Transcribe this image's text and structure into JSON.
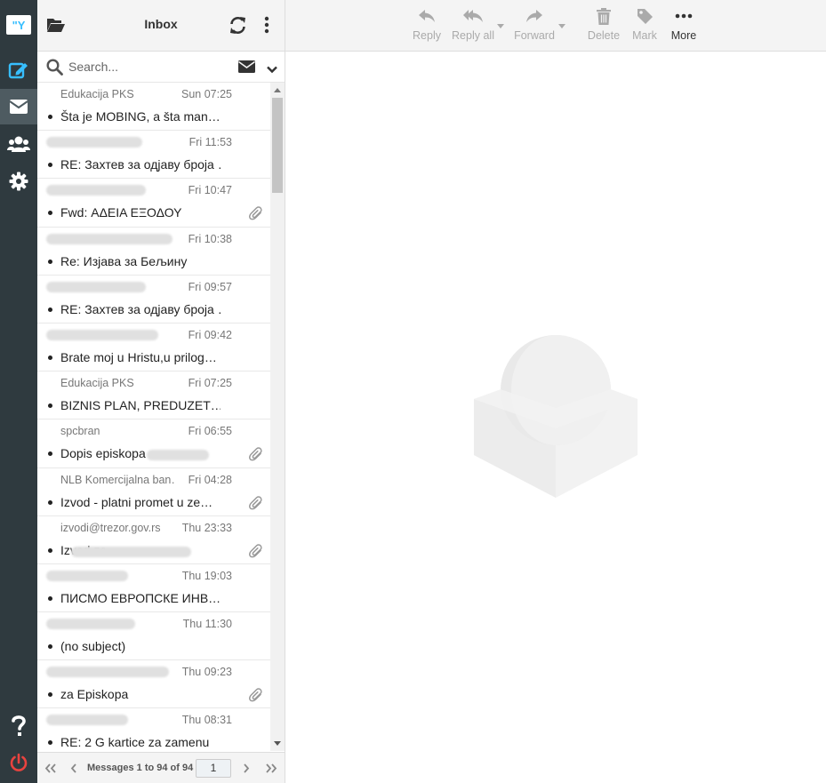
{
  "app": {
    "logo_text": "\"Y"
  },
  "rail": {
    "items": [
      {
        "name": "compose",
        "icon": "compose-icon"
      },
      {
        "name": "mail",
        "icon": "envelope-icon",
        "active": true
      },
      {
        "name": "contacts",
        "icon": "users-icon"
      },
      {
        "name": "settings",
        "icon": "gear-icon"
      },
      {
        "name": "help",
        "icon": "question-icon"
      },
      {
        "name": "logout",
        "icon": "power-icon"
      }
    ]
  },
  "list_header": {
    "title": "Inbox"
  },
  "search": {
    "placeholder": "Search..."
  },
  "messages": [
    {
      "from": "Edukacija PKS",
      "from_hidden": false,
      "date": "Sun 07:25",
      "subject": "Šta je MOBING, a šta man…",
      "attachment": false
    },
    {
      "from": "",
      "from_hidden": true,
      "date": "Fri 11:53",
      "subject": "RE: Захтев за одјаву броја …",
      "attachment": false
    },
    {
      "from": "",
      "from_hidden": true,
      "date": "Fri 10:47",
      "subject": "Fwd: ΑΔΕΙΑ ΕΞΟΔΟΥ",
      "attachment": true
    },
    {
      "from": "",
      "from_hidden": true,
      "date": "Fri 10:38",
      "subject": "Re: Изјава за Бељину",
      "attachment": false
    },
    {
      "from": "",
      "from_hidden": true,
      "date": "Fri 09:57",
      "subject": "RE: Захтев за одјаву броја …",
      "attachment": false
    },
    {
      "from": "",
      "from_hidden": true,
      "date": "Fri 09:42",
      "subject": "Brate moj u Hristu,u prilog…",
      "attachment": false
    },
    {
      "from": "Edukacija PKS",
      "from_hidden": false,
      "date": "Fri 07:25",
      "subject": "BIZNIS PLAN, PREDUZET…",
      "attachment": false
    },
    {
      "from": "spcbran",
      "from_hidden": false,
      "date": "Fri 06:55",
      "subject": "Dopis episkopa",
      "attachment": true
    },
    {
      "from": "NLB Komercijalna ban…",
      "from_hidden": false,
      "date": "Fri 04:28",
      "subject": "Izvod - platni promet u ze…",
      "attachment": true
    },
    {
      "from": "izvodi@trezor.gov.rs",
      "from_hidden": false,
      "date": "Thu 23:33",
      "subject": "Izvod za",
      "attachment": true
    },
    {
      "from": "",
      "from_hidden": true,
      "date": "Thu 19:03",
      "subject": "ПИСМО ЕВРОПСКЕ ИНВ…",
      "attachment": false
    },
    {
      "from": "",
      "from_hidden": true,
      "date": "Thu 11:30",
      "subject": "(no subject)",
      "attachment": false
    },
    {
      "from": "",
      "from_hidden": true,
      "date": "Thu 09:23",
      "subject": "za Episkopa",
      "attachment": true
    },
    {
      "from": "",
      "from_hidden": true,
      "date": "Thu 08:31",
      "subject": "RE: 2 G kartice za zamenu",
      "attachment": false
    }
  ],
  "footer": {
    "count_text": "Messages 1 to 94 of 94",
    "page": "1"
  },
  "toolbar": {
    "reply": "Reply",
    "reply_all": "Reply all",
    "forward": "Forward",
    "delete": "Delete",
    "mark": "Mark",
    "more": "More"
  },
  "colors": {
    "rail_bg": "#2f3a3f",
    "accent": "#37beff",
    "logout": "#e8433f"
  }
}
